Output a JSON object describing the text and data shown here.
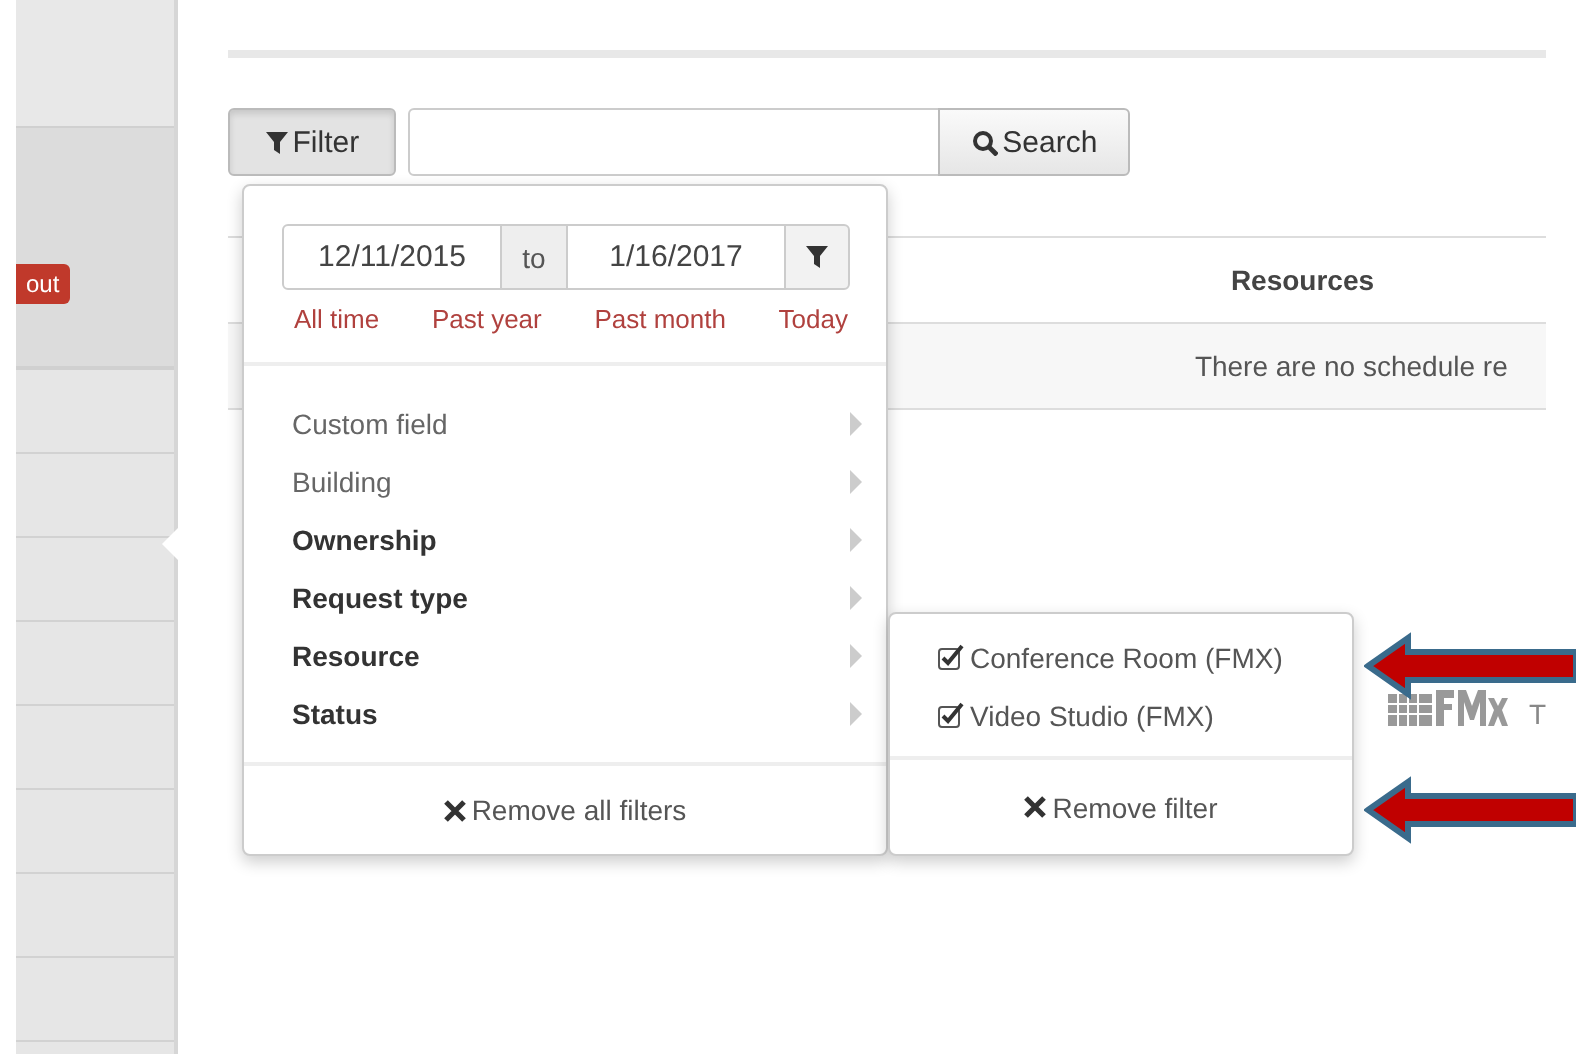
{
  "sidebar": {
    "badge": "out"
  },
  "toolbar": {
    "filter_button": "Filter",
    "search_button": "Search"
  },
  "table": {
    "columns": [
      "Resources"
    ],
    "empty_message": "There are no schedule re"
  },
  "logo_tail": "T",
  "filter_menu": {
    "date_from": "12/11/2015",
    "date_separator": "to",
    "date_to": "1/16/2017",
    "quick_ranges": [
      "All time",
      "Past year",
      "Past month",
      "Today"
    ],
    "items": [
      {
        "label": "Custom field",
        "applied": false
      },
      {
        "label": "Building",
        "applied": false
      },
      {
        "label": "Ownership",
        "applied": true
      },
      {
        "label": "Request type",
        "applied": true
      },
      {
        "label": "Resource",
        "applied": true
      },
      {
        "label": "Status",
        "applied": true
      }
    ],
    "remove_all": "Remove all filters"
  },
  "submenu": {
    "options": [
      {
        "label": "Conference Room (FMX)",
        "checked": true
      },
      {
        "label": "Video Studio (FMX)",
        "checked": true
      }
    ],
    "remove": "Remove filter"
  }
}
